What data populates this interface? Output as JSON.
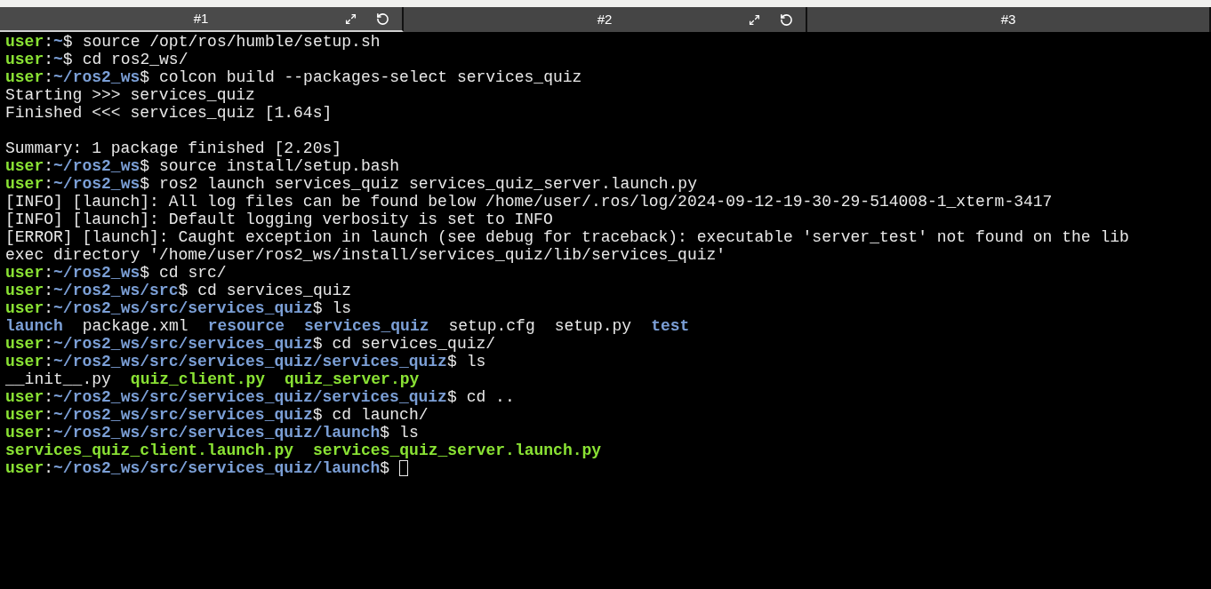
{
  "tabs": [
    {
      "label": "#1",
      "selected": true,
      "controls": true
    },
    {
      "label": "#2",
      "selected": false,
      "controls": true
    },
    {
      "label": "#3",
      "selected": false,
      "controls": false
    }
  ],
  "terminal": {
    "lines": [
      {
        "kind": "prompt",
        "user": "user",
        "separator": ":",
        "path": "~",
        "symbol": "$",
        "command": "source /opt/ros/humble/setup.sh"
      },
      {
        "kind": "prompt",
        "user": "user",
        "separator": ":",
        "path": "~",
        "symbol": "$",
        "command": "cd ros2_ws/"
      },
      {
        "kind": "prompt",
        "user": "user",
        "separator": ":",
        "path": "~/ros2_ws",
        "symbol": "$",
        "command": "colcon build --packages-select services_quiz"
      },
      {
        "kind": "output",
        "text": "Starting >>> services_quiz"
      },
      {
        "kind": "output",
        "text": "Finished <<< services_quiz [1.64s]"
      },
      {
        "kind": "blank"
      },
      {
        "kind": "output",
        "text": "Summary: 1 package finished [2.20s]"
      },
      {
        "kind": "prompt",
        "user": "user",
        "separator": ":",
        "path": "~/ros2_ws",
        "symbol": "$",
        "command": "source install/setup.bash"
      },
      {
        "kind": "prompt",
        "user": "user",
        "separator": ":",
        "path": "~/ros2_ws",
        "symbol": "$",
        "command": "ros2 launch services_quiz services_quiz_server.launch.py"
      },
      {
        "kind": "output",
        "text": "[INFO] [launch]: All log files can be found below /home/user/.ros/log/2024-09-12-19-30-29-514008-1_xterm-3417"
      },
      {
        "kind": "output",
        "text": "[INFO] [launch]: Default logging verbosity is set to INFO"
      },
      {
        "kind": "output",
        "text": "[ERROR] [launch]: Caught exception in launch (see debug for traceback): executable 'server_test' not found on the lib"
      },
      {
        "kind": "output",
        "text": "exec directory '/home/user/ros2_ws/install/services_quiz/lib/services_quiz'"
      },
      {
        "kind": "prompt",
        "user": "user",
        "separator": ":",
        "path": "~/ros2_ws",
        "symbol": "$",
        "command": "cd src/"
      },
      {
        "kind": "prompt",
        "user": "user",
        "separator": ":",
        "path": "~/ros2_ws/src",
        "symbol": "$",
        "command": "cd services_quiz"
      },
      {
        "kind": "prompt",
        "user": "user",
        "separator": ":",
        "path": "~/ros2_ws/src/services_quiz",
        "symbol": "$",
        "command": "ls"
      },
      {
        "kind": "listing",
        "entries": [
          {
            "name": "launch",
            "kind": "dir"
          },
          {
            "name": "package.xml",
            "kind": "file"
          },
          {
            "name": "resource",
            "kind": "dir"
          },
          {
            "name": "services_quiz",
            "kind": "dir"
          },
          {
            "name": "setup.cfg",
            "kind": "file"
          },
          {
            "name": "setup.py",
            "kind": "file"
          },
          {
            "name": "test",
            "kind": "dir"
          }
        ]
      },
      {
        "kind": "prompt",
        "user": "user",
        "separator": ":",
        "path": "~/ros2_ws/src/services_quiz",
        "symbol": "$",
        "command": "cd services_quiz/"
      },
      {
        "kind": "prompt",
        "user": "user",
        "separator": ":",
        "path": "~/ros2_ws/src/services_quiz/services_quiz",
        "symbol": "$",
        "command": "ls"
      },
      {
        "kind": "listing",
        "entries": [
          {
            "name": "__init__.py",
            "kind": "file"
          },
          {
            "name": "quiz_client.py",
            "kind": "exec"
          },
          {
            "name": "quiz_server.py",
            "kind": "exec"
          }
        ]
      },
      {
        "kind": "prompt",
        "user": "user",
        "separator": ":",
        "path": "~/ros2_ws/src/services_quiz/services_quiz",
        "symbol": "$",
        "command": "cd .."
      },
      {
        "kind": "prompt",
        "user": "user",
        "separator": ":",
        "path": "~/ros2_ws/src/services_quiz",
        "symbol": "$",
        "command": "cd launch/"
      },
      {
        "kind": "prompt",
        "user": "user",
        "separator": ":",
        "path": "~/ros2_ws/src/services_quiz/launch",
        "symbol": "$",
        "command": "ls"
      },
      {
        "kind": "listing",
        "entries": [
          {
            "name": "services_quiz_client.launch.py",
            "kind": "exec"
          },
          {
            "name": "services_quiz_server.launch.py",
            "kind": "exec"
          }
        ]
      },
      {
        "kind": "prompt",
        "user": "user",
        "separator": ":",
        "path": "~/ros2_ws/src/services_quiz/launch",
        "symbol": "$",
        "cursor": true
      }
    ]
  }
}
